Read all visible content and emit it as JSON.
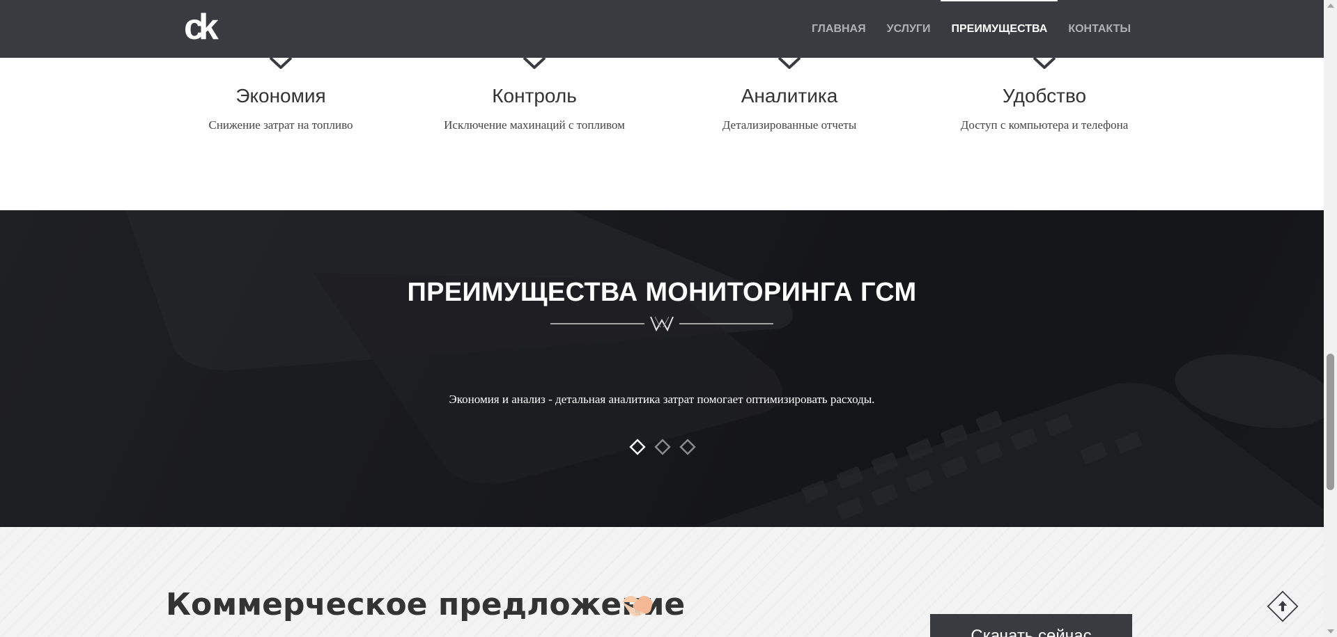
{
  "header": {
    "logo_text": "ck",
    "nav": [
      {
        "label": "ГЛАВНАЯ",
        "active": false
      },
      {
        "label": "УСЛУГИ",
        "active": false
      },
      {
        "label": "ПРЕИМУЩЕСТВА",
        "active": true
      },
      {
        "label": "КОНТАКТЫ",
        "active": false
      }
    ]
  },
  "features": [
    {
      "title": "Экономия",
      "desc": "Снижение затрат на топливо"
    },
    {
      "title": "Контроль",
      "desc": "Исключение махинаций с топливом"
    },
    {
      "title": "Аналитика",
      "desc": "Детализированные отчеты"
    },
    {
      "title": "Удобство",
      "desc": "Доступ с компьютера и телефона"
    }
  ],
  "banner": {
    "title": "ПРЕИМУЩЕСТВА МОНИТОРИНГА ГСМ",
    "text": "Экономия и анализ - детальная аналитика затрат помогает оптимизировать расходы.",
    "slides_total": 3,
    "active_slide": 1
  },
  "offer": {
    "title": "Коммерческое предложение",
    "emoji_icon": "handshake-icon",
    "download_label": "Скачать сейчас"
  },
  "icons": {
    "scroll_top": "arrow-up-icon"
  },
  "colors": {
    "header_bg": "#3a3b40",
    "accent_white": "#ffffff",
    "nav_inactive": "#aeb0b5"
  }
}
